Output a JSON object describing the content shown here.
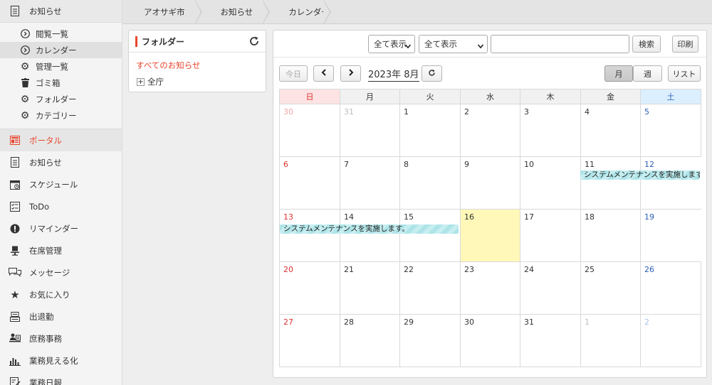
{
  "sidebar": {
    "top_label": "お知らせ",
    "sub_items": [
      {
        "label": "閲覧一覧",
        "icon": "circle-chevron-icon"
      },
      {
        "label": "カレンダー",
        "icon": "circle-chevron-icon",
        "active": true
      },
      {
        "label": "管理一覧",
        "icon": "gear-icon"
      },
      {
        "label": "ゴミ箱",
        "icon": "trash-icon"
      },
      {
        "label": "フォルダー",
        "icon": "gear-icon"
      },
      {
        "label": "カテゴリー",
        "icon": "gear-icon"
      }
    ],
    "items": [
      {
        "label": "ポータル",
        "icon": "portal-icon",
        "active": true
      },
      {
        "label": "お知らせ",
        "icon": "document-icon"
      },
      {
        "label": "スケジュール",
        "icon": "calendar-icon"
      },
      {
        "label": "ToDo",
        "icon": "checklist-icon"
      },
      {
        "label": "リマインダー",
        "icon": "exclamation-icon"
      },
      {
        "label": "在席管理",
        "icon": "desk-icon"
      },
      {
        "label": "メッセージ",
        "icon": "chat-icon"
      },
      {
        "label": "お気に入り",
        "icon": "star-icon"
      },
      {
        "label": "出退勤",
        "icon": "timecard-icon"
      },
      {
        "label": "庶務事務",
        "icon": "clerk-icon"
      },
      {
        "label": "業務見える化",
        "icon": "bar-chart-icon"
      },
      {
        "label": "業務日報",
        "icon": "report-icon"
      }
    ],
    "accent_color": "#e8452c"
  },
  "breadcrumb": [
    "アオサギ市",
    "お知らせ",
    "カレンダー"
  ],
  "folder_panel": {
    "title": "フォルダー",
    "all_link": "すべてのお知らせ",
    "tree_item": "全庁"
  },
  "toolbar": {
    "select1_value": "全て表示",
    "select2_value": "全て表示",
    "search_placeholder": "",
    "search_button": "検索",
    "print_button": "印刷",
    "today_button": "今日",
    "month_label": "2023年 8月",
    "view_month": "月",
    "view_week": "週",
    "view_list": "リスト"
  },
  "calendar": {
    "weekdays": [
      "日",
      "月",
      "火",
      "水",
      "木",
      "金",
      "土"
    ],
    "weeks": [
      [
        "30",
        "31",
        "1",
        "2",
        "3",
        "4",
        "5"
      ],
      [
        "6",
        "7",
        "8",
        "9",
        "10",
        "11",
        "12"
      ],
      [
        "13",
        "14",
        "15",
        "16",
        "17",
        "18",
        "19"
      ],
      [
        "20",
        "21",
        "22",
        "23",
        "24",
        "25",
        "26"
      ],
      [
        "27",
        "28",
        "29",
        "30",
        "31",
        "1",
        "2"
      ]
    ],
    "today": "16",
    "events": [
      {
        "title": "システムメンテナンスを実施します。",
        "start": "2023-08-11",
        "end": "2023-08-12"
      },
      {
        "title": "システムメンテナンスを実施します。",
        "start": "2023-08-13",
        "end": "2023-08-15"
      }
    ],
    "colors": {
      "sunday": "#e03030",
      "saturday": "#2a5fb5",
      "today_bg": "#fff8b8",
      "event_bg": "#aee4e8"
    }
  }
}
